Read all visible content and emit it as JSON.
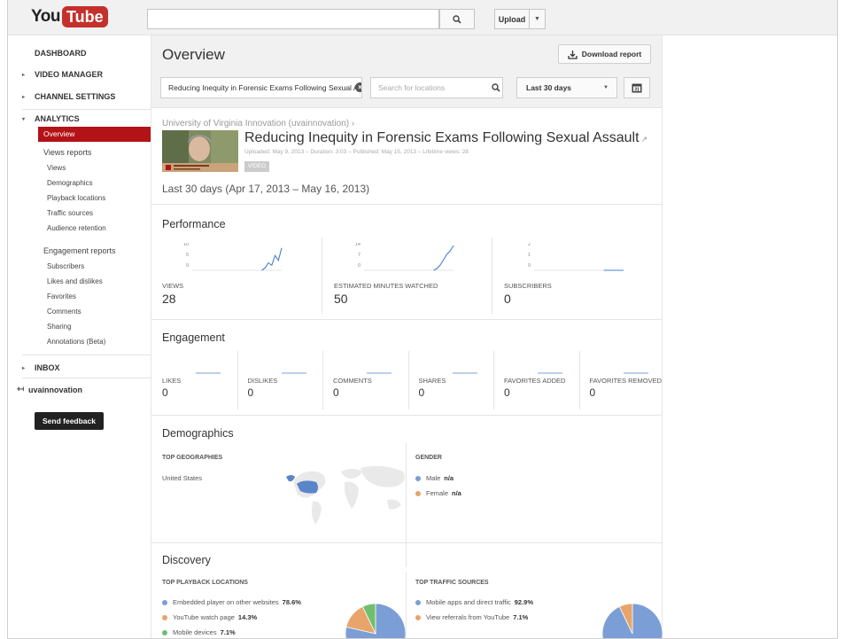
{
  "header": {
    "logo_you": "You",
    "logo_tube": "Tube",
    "upload_label": "Upload",
    "upload_menu_glyph": "▼"
  },
  "sidebar": {
    "dashboard": "DASHBOARD",
    "video_manager": "VIDEO MANAGER",
    "channel_settings": "CHANNEL SETTINGS",
    "analytics": "ANALYTICS",
    "overview": "Overview",
    "views_reports": "Views reports",
    "views_items": [
      "Views",
      "Demographics",
      "Playback locations",
      "Traffic sources",
      "Audience retention"
    ],
    "engagement_reports": "Engagement reports",
    "engagement_items": [
      "Subscribers",
      "Likes and dislikes",
      "Favorites",
      "Comments",
      "Sharing",
      "Annotations (Beta)"
    ],
    "inbox": "INBOX",
    "channel_name": "uvainnovation",
    "feedback": "Send feedback",
    "bullet_right": "▸",
    "bullet_down": "▾",
    "back_arrow": "↤"
  },
  "main": {
    "title": "Overview",
    "download": "Download report",
    "video_filter": "Reducing Inequity in Forensic Exams Following Sexual Assault",
    "location_placeholder": "Search for locations",
    "date_option": "Last 30 days",
    "calendar_label": "31",
    "channel": "University of Virginia Innovation (uvainnovation) ›",
    "video_title": "Reducing Inequity in Forensic Exams Following Sexual Assault",
    "video_meta": "Uploaded: May 9, 2013 – Duration: 3:03 – Published: May 15, 2013 – Lifetime views: 28",
    "video_badge": "VIDEO",
    "date_range": "Last 30 days (Apr 17, 2013 – May 16, 2013)"
  },
  "performance": {
    "title": "Performance",
    "metrics": [
      {
        "label": "VIEWS",
        "value": "28",
        "ticks": [
          "10",
          "5",
          "0"
        ],
        "series": [
          0,
          0,
          0,
          0,
          0,
          0,
          0,
          0,
          0,
          0,
          0,
          0,
          0,
          0,
          0,
          0,
          0,
          0,
          0,
          0,
          0,
          0,
          1,
          3,
          2,
          6,
          4,
          9
        ]
      },
      {
        "label": "ESTIMATED MINUTES WATCHED",
        "value": "50",
        "ticks": [
          "14",
          "7",
          "0"
        ],
        "series": [
          0,
          0,
          0,
          0,
          0,
          0,
          0,
          0,
          0,
          0,
          0,
          0,
          0,
          0,
          0,
          0,
          0,
          0,
          0,
          0,
          0,
          0,
          1,
          3,
          6,
          9,
          11,
          14
        ]
      },
      {
        "label": "SUBSCRIBERS",
        "value": "0",
        "ticks": [
          "2",
          "1",
          "0"
        ],
        "series": [
          0,
          0,
          0,
          0,
          0,
          0,
          0,
          0,
          0,
          0,
          0,
          0,
          0,
          0,
          0,
          0,
          0,
          0,
          0,
          0,
          0,
          0,
          0,
          0,
          0,
          0,
          0,
          0
        ]
      }
    ]
  },
  "engagement": {
    "title": "Engagement",
    "metrics": [
      {
        "label": "LIKES",
        "value": "0"
      },
      {
        "label": "DISLIKES",
        "value": "0"
      },
      {
        "label": "COMMENTS",
        "value": "0"
      },
      {
        "label": "SHARES",
        "value": "0"
      },
      {
        "label": "FAVORITES ADDED",
        "value": "0"
      },
      {
        "label": "FAVORITES REMOVED",
        "value": "0"
      }
    ]
  },
  "demographics": {
    "title": "Demographics",
    "geo_head": "TOP GEOGRAPHIES",
    "geo_item": "United States",
    "gender_head": "GENDER",
    "gender": [
      {
        "label": "Male",
        "value": "n/a",
        "color": "#7c9ed6"
      },
      {
        "label": "Female",
        "value": "n/a",
        "color": "#e8a46a"
      }
    ]
  },
  "discovery": {
    "title": "Discovery",
    "playback_head": "TOP PLAYBACK LOCATIONS",
    "playback": [
      {
        "label": "Embedded player on other websites",
        "value": "78.6%",
        "share": 78.6,
        "color": "#7c9ed6"
      },
      {
        "label": "YouTube watch page",
        "value": "14.3%",
        "share": 14.3,
        "color": "#e8a46a"
      },
      {
        "label": "Mobile devices",
        "value": "7.1%",
        "share": 7.1,
        "color": "#6fbf6f"
      }
    ],
    "traffic_head": "TOP TRAFFIC SOURCES",
    "traffic": [
      {
        "label": "Mobile apps and direct traffic",
        "value": "92.9%",
        "share": 92.9,
        "color": "#7c9ed6"
      },
      {
        "label": "View referrals from YouTube",
        "value": "7.1%",
        "share": 7.1,
        "color": "#e8a46a"
      }
    ]
  }
}
